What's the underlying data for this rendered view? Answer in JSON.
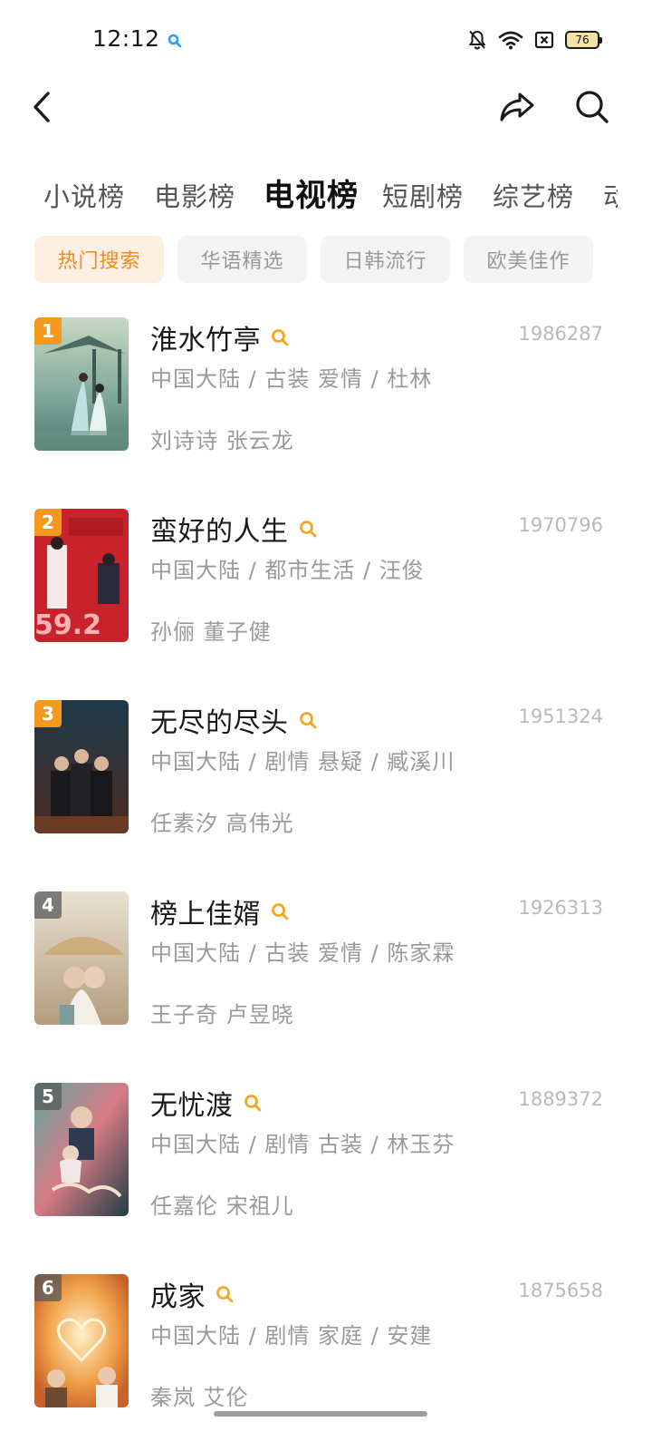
{
  "status_bar": {
    "time": "12:12",
    "battery": "76",
    "icons": [
      "search-icon",
      "bell-off-icon",
      "wifi-icon",
      "sim-off-icon",
      "battery-icon"
    ]
  },
  "header": {
    "icons": [
      "back-icon",
      "share-icon",
      "search-icon"
    ]
  },
  "tabs": [
    {
      "label": "小说榜",
      "active": false
    },
    {
      "label": "电影榜",
      "active": false
    },
    {
      "label": "电视榜",
      "active": true
    },
    {
      "label": "短剧榜",
      "active": false
    },
    {
      "label": "综艺榜",
      "active": false
    },
    {
      "label": "动",
      "active": false
    }
  ],
  "chips": [
    {
      "label": "热门搜索",
      "active": true
    },
    {
      "label": "华语精选",
      "active": false
    },
    {
      "label": "日韩流行",
      "active": false
    },
    {
      "label": "欧美佳作",
      "active": false
    }
  ],
  "colors": {
    "accent": "#f28a1c",
    "chip_active_bg": "#fdf0e2",
    "chip_bg": "#f4f4f4",
    "rank_top": "#f39a1e"
  },
  "items": [
    {
      "rank": "1",
      "title": "淮水竹亭",
      "heat": "1986287",
      "meta": "中国大陆 / 古装 爱情 / 杜林",
      "cast": "刘诗诗 张云龙"
    },
    {
      "rank": "2",
      "title": "蛮好的人生",
      "heat": "1970796",
      "meta": "中国大陆 / 都市生活 / 汪俊",
      "cast": "孙俪 董子健"
    },
    {
      "rank": "3",
      "title": "无尽的尽头",
      "heat": "1951324",
      "meta": "中国大陆 / 剧情 悬疑 / 臧溪川",
      "cast": "任素汐 高伟光"
    },
    {
      "rank": "4",
      "title": "榜上佳婿",
      "heat": "1926313",
      "meta": "中国大陆 / 古装 爱情 / 陈家霖",
      "cast": "王子奇 卢昱晓"
    },
    {
      "rank": "5",
      "title": "无忧渡",
      "heat": "1889372",
      "meta": "中国大陆 / 剧情 古装 / 林玉芬",
      "cast": "任嘉伦 宋祖儿"
    },
    {
      "rank": "6",
      "title": "成家",
      "heat": "1875658",
      "meta": "中国大陆 / 剧情 家庭 / 安建",
      "cast": "秦岚 艾伦"
    }
  ]
}
